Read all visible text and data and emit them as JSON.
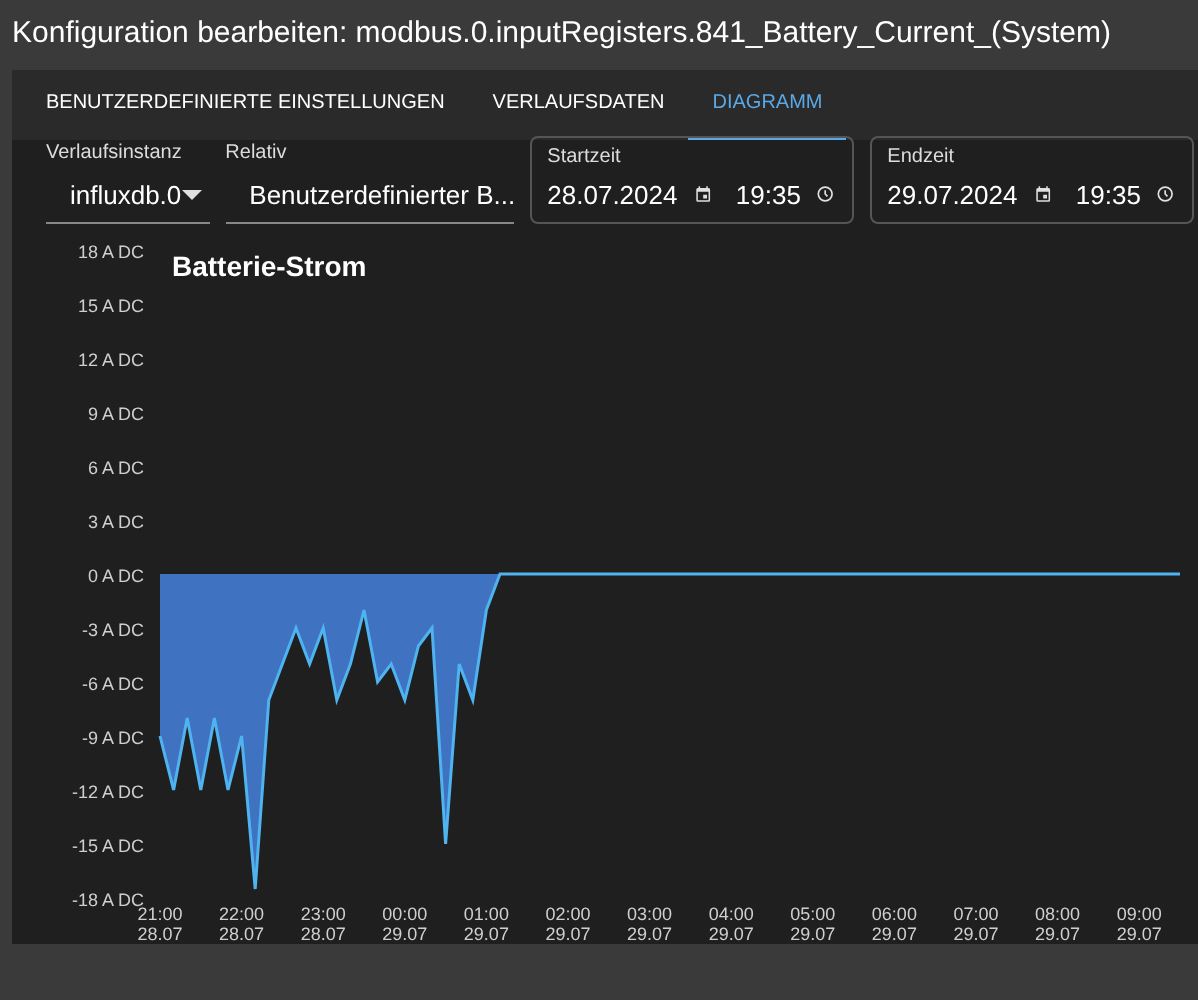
{
  "window": {
    "title": "Konfiguration bearbeiten: modbus.0.inputRegisters.841_Battery_Current_(System)"
  },
  "tabs": [
    {
      "label": "BENUTZERDEFINIERTE EINSTELLUNGEN",
      "selected": false
    },
    {
      "label": "VERLAUFSDATEN",
      "selected": false
    },
    {
      "label": "DIAGRAMM",
      "selected": true
    }
  ],
  "controls": {
    "instance": {
      "label": "Verlaufsinstanz",
      "value": "influxdb.0"
    },
    "relative": {
      "label": "Relativ",
      "value": "Benutzerdefinierter B..."
    },
    "start": {
      "label": "Startzeit",
      "date": "28.07.2024",
      "time": "19:35"
    },
    "end": {
      "label": "Endzeit",
      "date": "29.07.2024",
      "time": "19:35"
    }
  },
  "chart": {
    "chart_data": {
      "type": "area",
      "title": "Batterie-Strom",
      "categories": [
        "21:00 28.07",
        null,
        null,
        null,
        null,
        null,
        "22:00 28.07",
        null,
        null,
        null,
        null,
        null,
        "23:00 28.07",
        null,
        null,
        null,
        null,
        null,
        "00:00 29.07",
        null,
        null,
        null,
        null,
        null,
        "01:00 29.07",
        null,
        null,
        null,
        null,
        null,
        "02:00 29.07",
        null,
        null,
        null,
        null,
        null,
        "03:00 29.07",
        null,
        null,
        null,
        null,
        null,
        "04:00 29.07",
        null,
        null,
        null,
        null,
        null,
        "05:00 29.07",
        null,
        null,
        null,
        null,
        null,
        "06:00 29.07",
        null,
        null,
        null,
        null,
        null,
        "07:00 29.07",
        null,
        null,
        null,
        null,
        null,
        "08:00 29.07",
        null,
        null,
        null,
        null,
        null,
        "09:00 29.07",
        null,
        null,
        null
      ],
      "series": [
        {
          "color": "#4fb3f0",
          "values": [
            -9,
            -12,
            -8,
            -12,
            -8,
            -12,
            -9,
            -17.5,
            -7,
            -5,
            -3,
            -5,
            -3,
            -7,
            -5,
            -2,
            -6,
            -5,
            -7,
            -4,
            -3,
            -15,
            -5,
            -7,
            -2,
            0,
            0,
            0,
            0,
            0,
            0,
            0,
            0,
            0,
            0,
            0,
            0,
            0,
            0,
            0,
            0,
            0,
            0,
            0,
            0,
            0,
            0,
            0,
            0,
            0,
            0,
            0,
            0,
            0,
            0,
            0,
            0,
            0,
            0,
            0,
            0,
            0,
            0,
            0,
            0,
            0,
            0,
            0,
            0,
            0,
            0,
            0,
            0,
            0,
            0,
            0
          ]
        }
      ],
      "ylim": [
        -18,
        18
      ],
      "yticks": [
        {
          "value": 18,
          "label": "18 A DC"
        },
        {
          "value": 15,
          "label": "15 A DC"
        },
        {
          "value": 12,
          "label": "12 A DC"
        },
        {
          "value": 9,
          "label": "9 A DC"
        },
        {
          "value": 6,
          "label": "6 A DC"
        },
        {
          "value": 3,
          "label": "3 A DC"
        },
        {
          "value": 0,
          "label": "0 A DC"
        },
        {
          "value": -3,
          "label": "-3 A DC"
        },
        {
          "value": -6,
          "label": "-6 A DC"
        },
        {
          "value": -9,
          "label": "-9 A DC"
        },
        {
          "value": -12,
          "label": "-12 A DC"
        },
        {
          "value": -15,
          "label": "-15 A DC"
        },
        {
          "value": -18,
          "label": "-18 A DC"
        }
      ]
    }
  }
}
